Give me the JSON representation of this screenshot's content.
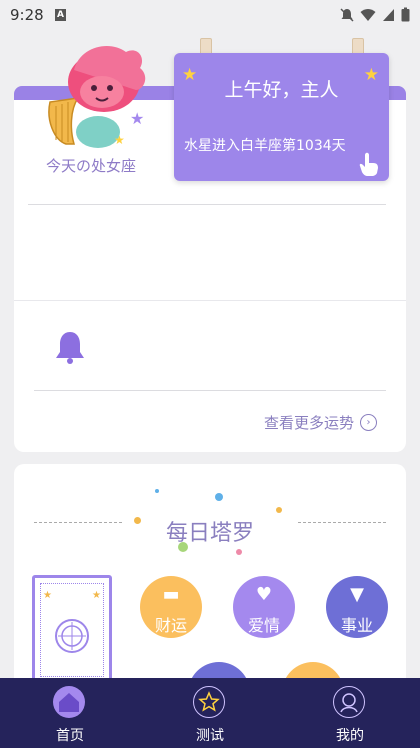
{
  "status_bar": {
    "time": "9:28",
    "app_icon_letter": "A"
  },
  "sign": {
    "caption": "今天の处女座"
  },
  "greeting": {
    "hello": "上午好，主人",
    "astro_event": "水星进入白羊座第1034天"
  },
  "more_fortune_link": "查看更多运势",
  "tarot": {
    "title": "每日塔罗",
    "categories": [
      {
        "label": "财运",
        "color": "#fbbf5e"
      },
      {
        "label": "爱情",
        "color": "#a489ee"
      },
      {
        "label": "事业",
        "color": "#6e6fd6"
      }
    ]
  },
  "tabbar": {
    "items": [
      {
        "label": "首页",
        "icon": "home-icon",
        "active": true
      },
      {
        "label": "测试",
        "icon": "star-icon",
        "active": false
      },
      {
        "label": "我的",
        "icon": "profile-icon",
        "active": false
      }
    ]
  },
  "colors": {
    "accent": "#9d86ea",
    "tabbar_bg": "#25235b",
    "link": "#8a7fbf"
  }
}
